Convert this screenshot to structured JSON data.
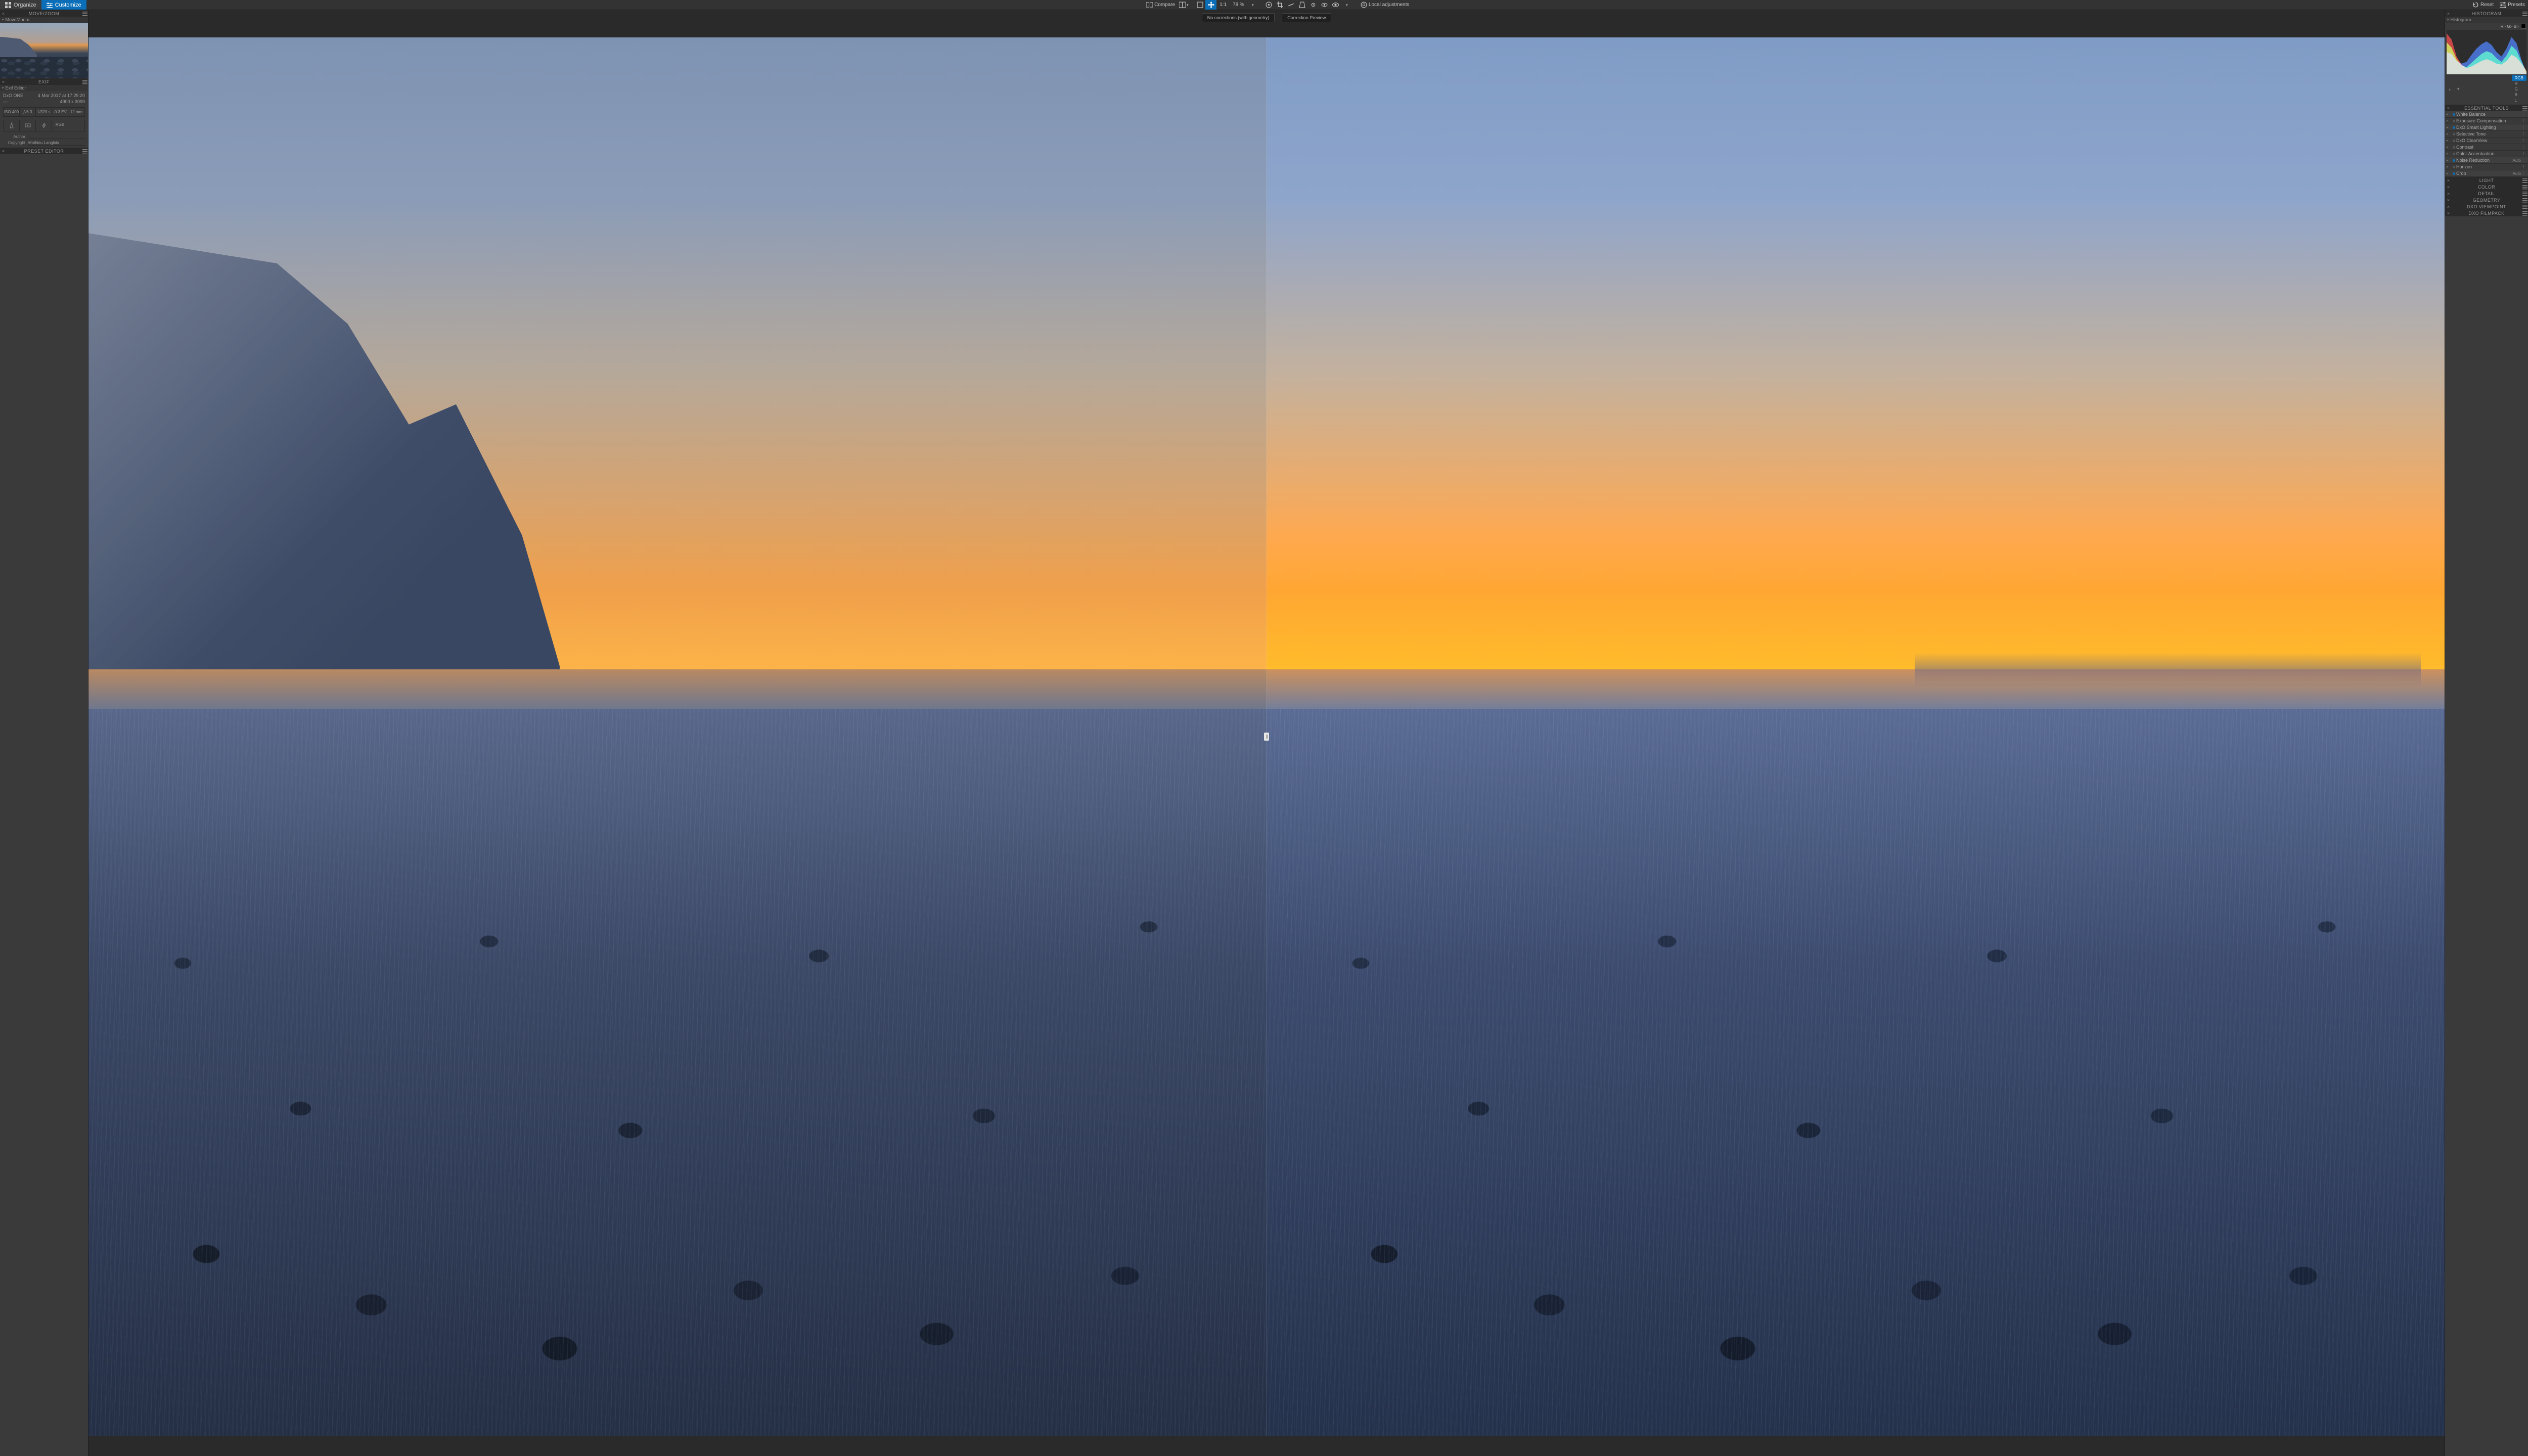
{
  "topbar": {
    "organize": "Organize",
    "customize": "Customize",
    "compare": "Compare",
    "zoom_value": "78 %",
    "one_to_one": "1:1",
    "local_adjustments": "Local adjustments",
    "reset": "Reset",
    "presets": "Presets"
  },
  "canvas": {
    "label_left": "No corrections (with geometry)",
    "label_right": "Correction Preview"
  },
  "left": {
    "movezoom": {
      "header": "MOVE/ZOOM",
      "sub": "Move/Zoom"
    },
    "exif": {
      "header": "EXIF",
      "sub": "Exif Editor",
      "camera": "DxO ONE",
      "lens": "—",
      "datetime": "4 Mar 2017 at 17:25:20",
      "dimensions": "4900 x 3099",
      "cells": [
        "ISO 400",
        "ƒ/6.3",
        "1/320 s",
        "-0.3 EV",
        "12 mm"
      ],
      "icon_row_last": "RGB",
      "author_label": "Author",
      "author_value": "",
      "copyright_label": "Copyright",
      "copyright_value": "Mathieu Langlois"
    },
    "preset": {
      "header": "PRESET EDITOR"
    }
  },
  "right": {
    "histogram": {
      "header": "HISTOGRAM",
      "sub": "Histogram",
      "readout": "R:- G:- B:-"
    },
    "channels": [
      "RGB",
      "R",
      "G",
      "B",
      "L"
    ],
    "essential": {
      "header": "ESSENTIAL TOOLS",
      "tools": [
        {
          "label": "White Balance",
          "on": true,
          "auto": ""
        },
        {
          "label": "Exposure Compensation",
          "on": false,
          "auto": ""
        },
        {
          "label": "DxO Smart Lighting",
          "on": true,
          "auto": ""
        },
        {
          "label": "Selective Tone",
          "on": false,
          "auto": ""
        },
        {
          "label": "DxO ClearView",
          "on": false,
          "auto": ""
        },
        {
          "label": "Contrast",
          "on": false,
          "auto": ""
        },
        {
          "label": "Color Accentuation",
          "on": false,
          "auto": ""
        },
        {
          "label": "Noise Reduction",
          "on": true,
          "auto": "Auto"
        },
        {
          "label": "Horizon",
          "on": false,
          "auto": ""
        },
        {
          "label": "Crop",
          "on": true,
          "auto": "Auto"
        }
      ]
    },
    "sections": [
      "LIGHT",
      "COLOR",
      "DETAIL",
      "GEOMETRY",
      "DXO VIEWPOINT",
      "DXO FILMPACK"
    ]
  },
  "chart_data": {
    "type": "area",
    "title": "Histogram",
    "xlabel": "",
    "ylabel": "",
    "xlim": [
      0,
      255
    ],
    "ylim": [
      0,
      100
    ],
    "x": [
      0,
      16,
      32,
      48,
      64,
      80,
      96,
      112,
      128,
      144,
      160,
      176,
      192,
      208,
      224,
      240,
      255
    ],
    "series": [
      {
        "name": "R",
        "color": "#ff2a2a",
        "values": [
          92,
          78,
          40,
          22,
          14,
          18,
          24,
          30,
          34,
          30,
          24,
          22,
          30,
          44,
          38,
          24,
          8
        ]
      },
      {
        "name": "G",
        "color": "#2aff2a",
        "values": [
          72,
          60,
          34,
          20,
          16,
          26,
          36,
          46,
          52,
          48,
          36,
          28,
          42,
          64,
          54,
          28,
          6
        ]
      },
      {
        "name": "B",
        "color": "#2a6bff",
        "values": [
          50,
          46,
          30,
          24,
          28,
          44,
          58,
          68,
          74,
          66,
          50,
          40,
          58,
          84,
          70,
          32,
          4
        ]
      }
    ]
  }
}
